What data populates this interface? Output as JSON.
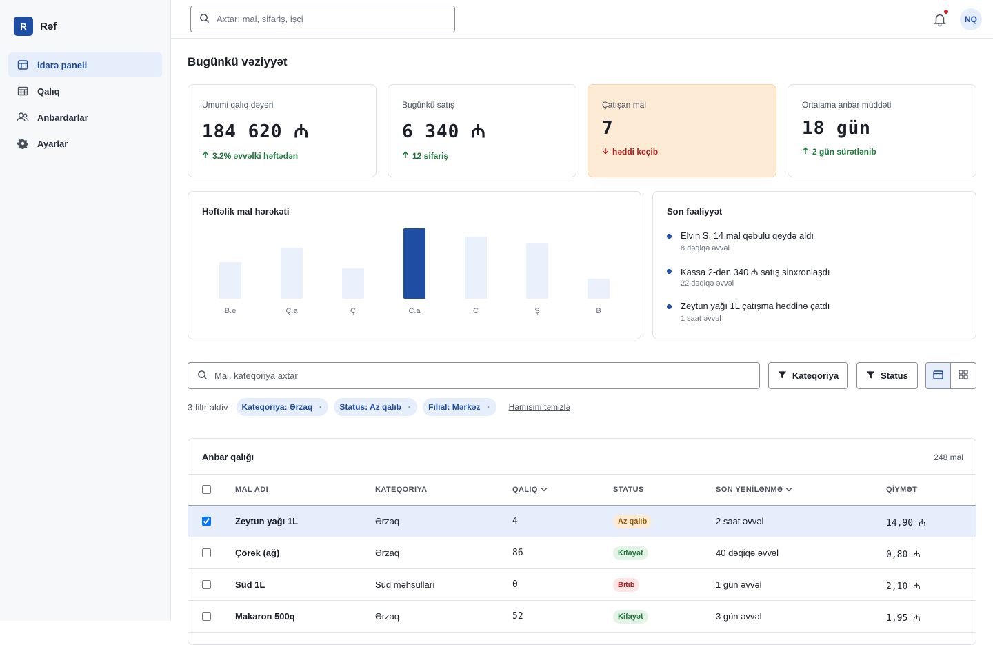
{
  "brand": {
    "logo_letter": "R",
    "name": "Rəf"
  },
  "sidebar": {
    "items": [
      {
        "label": "İdarə paneli",
        "icon": "dashboard-icon",
        "active": true
      },
      {
        "label": "Qalıq",
        "icon": "inventory-icon",
        "active": false
      },
      {
        "label": "Anbardarlar",
        "icon": "users-icon",
        "active": false
      },
      {
        "label": "Ayarlar",
        "icon": "gear-icon",
        "active": false
      }
    ]
  },
  "topbar": {
    "search_placeholder": "Axtar: mal, sifariş, işçi",
    "avatar_initials": "NQ",
    "has_notification": true
  },
  "page": {
    "title": "Bugünkü vəziyyət"
  },
  "kpis": [
    {
      "label": "Ümumi qalıq dəyəri",
      "value": "184 620 ₼",
      "trend": "3.2% əvvəlki həftədən",
      "direction": "up"
    },
    {
      "label": "Bugünkü satış",
      "value": "6 340 ₼",
      "trend": "12 sifariş",
      "direction": "up"
    },
    {
      "label": "Çatışan mal",
      "value": "7",
      "trend": "həddi keçib",
      "direction": "down"
    },
    {
      "label": "Ortalama anbar müddəti",
      "value": "18 gün",
      "trend": "2 gün sürətlənib",
      "direction": "up"
    }
  ],
  "chart": {
    "title": "Həftəlik mal hərəkəti"
  },
  "chart_data": {
    "type": "bar",
    "title": "Həftəlik mal hərəkəti",
    "categories": [
      "B.e",
      "Ç.a",
      "Ç",
      "C.a",
      "C",
      "Ş",
      "B"
    ],
    "values": [
      53,
      74,
      44,
      102,
      90,
      81,
      29
    ],
    "highlight_index": 3,
    "colors": {
      "bar": "#eaf1fd",
      "highlight": "#1d4ea3"
    },
    "xlabel": "",
    "ylabel": "",
    "grid": false
  },
  "activity": {
    "title": "Son fəaliyyət",
    "items": [
      {
        "text": "Elvin S. 14 mal qəbulu qeydə aldı",
        "time": "8 dəqiqə əvvəl"
      },
      {
        "text": "Kassa 2-dən 340 ₼ satış sinxronlaşdı",
        "time": "22 dəqiqə əvvəl"
      },
      {
        "text": "Zeytun yağı 1L çatışma həddinə çatdı",
        "time": "1 saat əvvəl"
      }
    ]
  },
  "filters": {
    "search_placeholder": "Mal, kateqoriya axtar",
    "category_button": "Kateqoriya",
    "status_button": "Status",
    "active_count_label": "3 filtr aktiv",
    "chips": [
      "Kateqoriya: Ərzaq",
      "Status: Az qalıb",
      "Filial: Mərkəz"
    ],
    "chip_remove_glyph": "•",
    "clear_all": "Hamısını təmizlə"
  },
  "table": {
    "title": "Anbar qalığı",
    "count": "248 mal",
    "columns": [
      "MAL ADI",
      "KATEQORIYA",
      "QALIQ",
      "STATUS",
      "SON YENİLƏNMƏ",
      "QİYMƏT"
    ],
    "rows": [
      {
        "name": "Zeytun yağı 1L",
        "category": "Ərzaq",
        "stock": "4",
        "status": "Az qalıb",
        "status_kind": "low",
        "updated": "2 saat əvvəl",
        "price": "14,90 ₼",
        "checked": true
      },
      {
        "name": "Çörək (ağ)",
        "category": "Ərzaq",
        "stock": "86",
        "status": "Kifayət",
        "status_kind": "ok",
        "updated": "40 dəqiqə əvvəl",
        "price": "0,80 ₼",
        "checked": false
      },
      {
        "name": "Süd 1L",
        "category": "Süd məhsulları",
        "stock": "0",
        "status": "Bitib",
        "status_kind": "out",
        "updated": "1 gün əvvəl",
        "price": "2,10 ₼",
        "checked": false
      },
      {
        "name": "Makaron 500q",
        "category": "Ərzaq",
        "stock": "52",
        "status": "Kifayət",
        "status_kind": "ok",
        "updated": "3 gün əvvəl",
        "price": "1,95 ₼",
        "checked": false
      }
    ]
  }
}
